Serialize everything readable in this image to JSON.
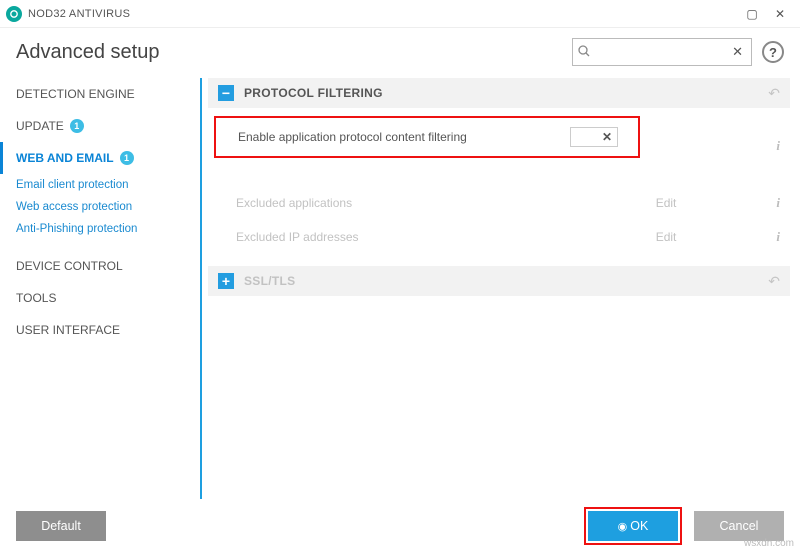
{
  "titlebar": {
    "product": "NOD32 ANTIVIRUS"
  },
  "header": {
    "title": "Advanced setup",
    "search": {
      "value": "",
      "placeholder": ""
    }
  },
  "sidebar": {
    "items": [
      {
        "label": "DETECTION ENGINE"
      },
      {
        "label": "UPDATE",
        "badge": "1"
      },
      {
        "label": "WEB AND EMAIL",
        "badge": "1",
        "active": true
      },
      {
        "label": "DEVICE CONTROL"
      },
      {
        "label": "TOOLS"
      },
      {
        "label": "USER INTERFACE"
      }
    ],
    "subs": [
      {
        "label": "Email client protection"
      },
      {
        "label": "Web access protection"
      },
      {
        "label": "Anti-Phishing protection"
      }
    ]
  },
  "sections": {
    "protocol": {
      "title": "PROTOCOL FILTERING",
      "enable_label": "Enable application protocol content filtering",
      "toggle_state": "✕",
      "excluded_apps_label": "Excluded applications",
      "excluded_ips_label": "Excluded IP addresses",
      "edit_label": "Edit"
    },
    "ssltls": {
      "title": "SSL/TLS"
    }
  },
  "footer": {
    "default_label": "Default",
    "ok_label": "OK",
    "cancel_label": "Cancel"
  },
  "watermark": "wsxdn.com"
}
